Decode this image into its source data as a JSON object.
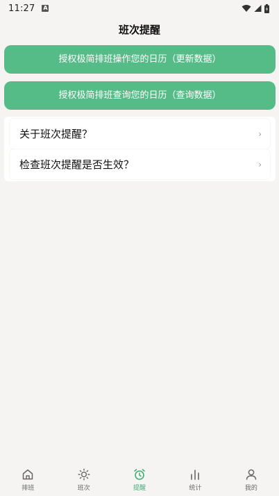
{
  "status_bar": {
    "time": "11:27",
    "notification_badge": "A"
  },
  "header": {
    "title": "班次提醒"
  },
  "actions": {
    "update_label": "授权极简排班操作您的日历（更新数据）",
    "query_label": "授权极简排班查询您的日历（查询数据）"
  },
  "menu": {
    "items": [
      {
        "label": "关于班次提醒？",
        "arrow": "›"
      },
      {
        "label": "检查班次提醒是否生效？",
        "arrow": "›"
      }
    ]
  },
  "nav": {
    "items": [
      {
        "label": "排班",
        "icon": "home-icon"
      },
      {
        "label": "班次",
        "icon": "sun-icon"
      },
      {
        "label": "提醒",
        "icon": "alarm-clock-icon"
      },
      {
        "label": "统计",
        "icon": "bar-chart-icon"
      },
      {
        "label": "我的",
        "icon": "person-icon"
      }
    ],
    "active_index": 2
  },
  "colors": {
    "accent": "#55bc87",
    "nav_active": "#3fae74",
    "background": "#f5f4f2"
  }
}
